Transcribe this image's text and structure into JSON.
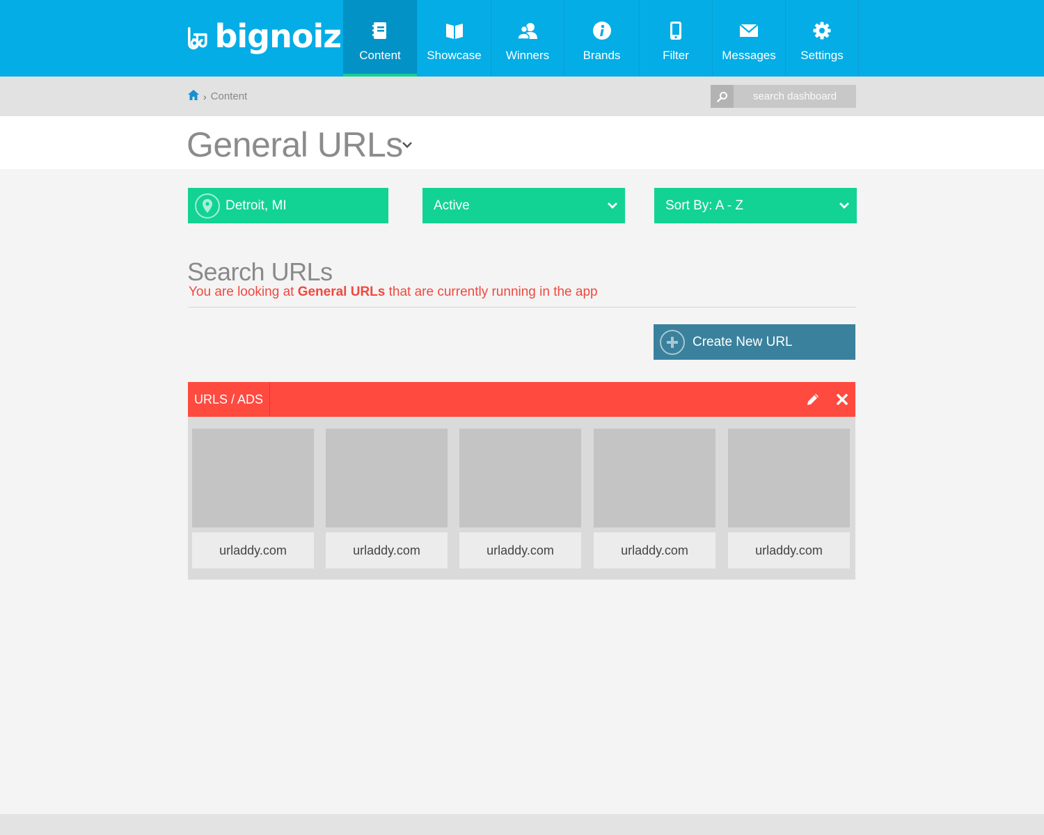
{
  "brand": {
    "name": "bignoiz"
  },
  "nav": {
    "items": [
      {
        "label": "Content",
        "icon": "notebook-icon",
        "active": true
      },
      {
        "label": "Showcase",
        "icon": "open-book-icon",
        "active": false
      },
      {
        "label": "Winners",
        "icon": "users-icon",
        "active": false
      },
      {
        "label": "Brands",
        "icon": "info-circle-icon",
        "active": false
      },
      {
        "label": "Filter",
        "icon": "mobile-phone-icon",
        "active": false
      },
      {
        "label": "Messages",
        "icon": "envelope-icon",
        "active": false
      },
      {
        "label": "Settings",
        "icon": "gear-icon",
        "active": false
      }
    ]
  },
  "breadcrumb": {
    "current": "Content"
  },
  "search": {
    "placeholder": "search dashboard"
  },
  "page": {
    "title": "General URLs"
  },
  "filters": {
    "location": "Detroit, MI",
    "status": "Active",
    "sort": "Sort By: A - Z"
  },
  "section": {
    "title": "Search URLs",
    "subtitle_prefix": "You are looking at ",
    "subtitle_bold": "General URLs",
    "subtitle_suffix": " that are currently running in the app"
  },
  "create_button": {
    "label": "Create New URL"
  },
  "panel": {
    "title": "URLS / ADS",
    "cards": [
      {
        "label": "urladdy.com"
      },
      {
        "label": "urladdy.com"
      },
      {
        "label": "urladdy.com"
      },
      {
        "label": "urladdy.com"
      },
      {
        "label": "urladdy.com"
      }
    ]
  },
  "colors": {
    "topbar": "#04ade5",
    "active_tab": "#0392c6",
    "active_underline": "#12d18f",
    "filter_green": "#12d394",
    "accent_red": "#ff4a40",
    "create_button": "#3a819d"
  }
}
